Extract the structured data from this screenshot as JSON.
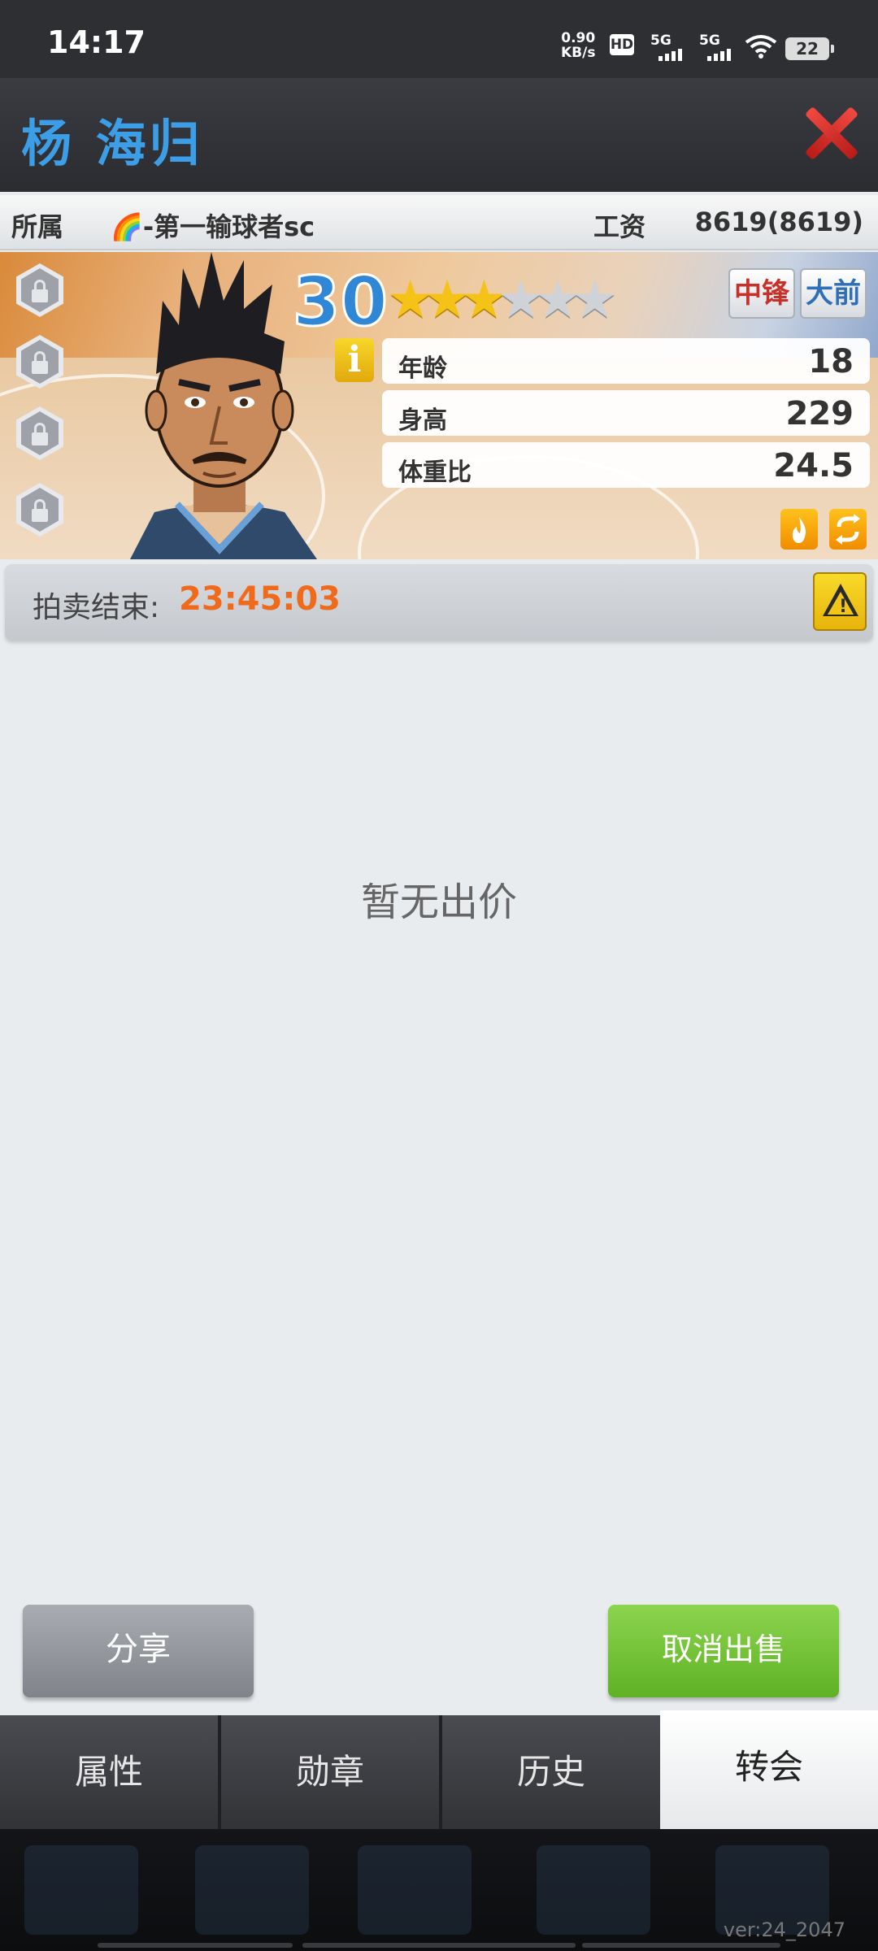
{
  "status_bar": {
    "time": "14:17",
    "net_speed_value": "0.90",
    "net_speed_unit": "KB/s",
    "hd_badge": "HD",
    "sim1": "5G",
    "sim2": "5G",
    "battery": "22"
  },
  "header": {
    "player_name": "杨 海归"
  },
  "info_row": {
    "team_label": "所属",
    "team_name": "🌈-第一输球者sc",
    "salary_label": "工资",
    "salary_value": "8619(8619)"
  },
  "card": {
    "rating": "30",
    "stars_filled": 3,
    "stars_total": 6,
    "positions": [
      "中锋",
      "大前"
    ],
    "info_icon": "i",
    "stats": [
      {
        "label": "年龄",
        "value": "18"
      },
      {
        "label": "身高",
        "value": "229"
      },
      {
        "label": "体重比",
        "value": "24.5"
      }
    ],
    "locked_slots": 4
  },
  "auction": {
    "label": "拍卖结束:",
    "countdown": "23:45:03"
  },
  "bids": {
    "empty_message": "暂无出价"
  },
  "actions": {
    "share": "分享",
    "cancel_sale": "取消出售"
  },
  "tabs": [
    {
      "label": "属性",
      "active": false
    },
    {
      "label": "勋章",
      "active": false
    },
    {
      "label": "历史",
      "active": false
    },
    {
      "label": "转会",
      "active": true
    }
  ],
  "footer": {
    "version": "ver:24_2047"
  },
  "colors": {
    "name_blue": "#3d9ee8",
    "countdown_orange": "#f06a1c",
    "cancel_green": "#6cc233",
    "position_red": "#c8302a",
    "position_blue": "#2f6fb8"
  }
}
